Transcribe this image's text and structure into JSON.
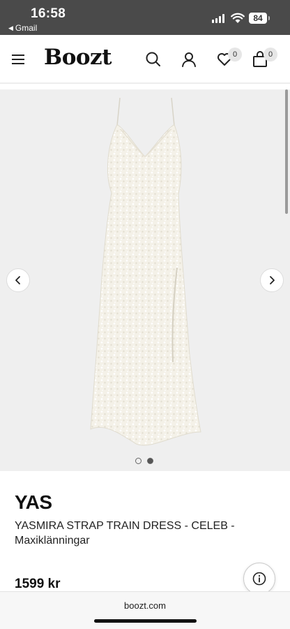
{
  "status_bar": {
    "time": "16:58",
    "back_app": "Gmail",
    "battery": "84"
  },
  "header": {
    "logo": "Boozt",
    "wishlist_count": "0",
    "cart_count": "0"
  },
  "gallery": {
    "image": "white-sequin-dress",
    "total_images": 2,
    "active_index": 2
  },
  "product": {
    "brand": "YAS",
    "name": "YASMIRA STRAP TRAIN DRESS - CELEB - Maxiklänningar",
    "price": "1599 kr"
  },
  "browser": {
    "url": "boozt.com"
  },
  "colors": {
    "status_bar": "#4a4a4a",
    "gallery_bg": "#efefef",
    "dress": "#f4f1e8"
  }
}
